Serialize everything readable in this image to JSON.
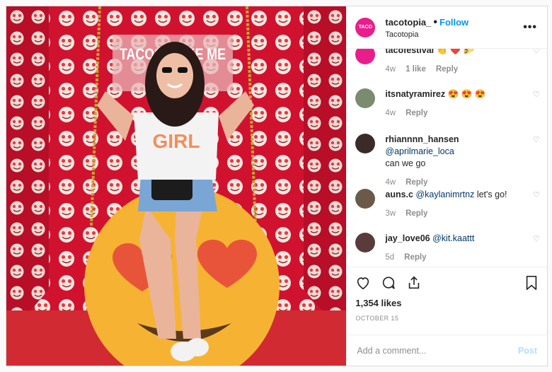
{
  "post": {
    "username": "tacotopia_",
    "follow_label": "Follow",
    "location": "Tacotopia",
    "more_icon": "more-dots-icon",
    "logo_text": "TACO"
  },
  "comments": [
    {
      "username": "tacofestival",
      "text": "👏 ❤️ 🌮",
      "time": "4w",
      "likes": "1 like",
      "reply": "Reply",
      "avatar_color": "#e91e8c"
    },
    {
      "username": "itsnatyramirez",
      "text": "😍 😍 😍",
      "time": "4w",
      "reply": "Reply",
      "avatar_color": "#7a8b6f"
    },
    {
      "username": "rhiannnn_hansen",
      "mention": "@aprilmarie_loca",
      "text": "can we go",
      "time": "4w",
      "reply": "Reply",
      "avatar_color": "#3b2a2a"
    },
    {
      "username": "auns.c",
      "mention": "@kaylanimrtnz",
      "text": "let's go!",
      "time": "3w",
      "reply": "Reply",
      "avatar_color": "#6b5a4a"
    },
    {
      "username": "jay_love06",
      "mention": "@kit.kaattt",
      "text": "",
      "time": "5d",
      "reply": "Reply",
      "avatar_color": "#5a3b3b"
    }
  ],
  "likes": "1,354 likes",
  "date": "OCTOBER 15",
  "add_comment": {
    "placeholder": "Add a comment...",
    "post_label": "Post"
  },
  "photo": {
    "sign_text": "TACOS MAKE ME"
  },
  "colors": {
    "accent": "#0095f6",
    "wall": "#c8102e"
  }
}
